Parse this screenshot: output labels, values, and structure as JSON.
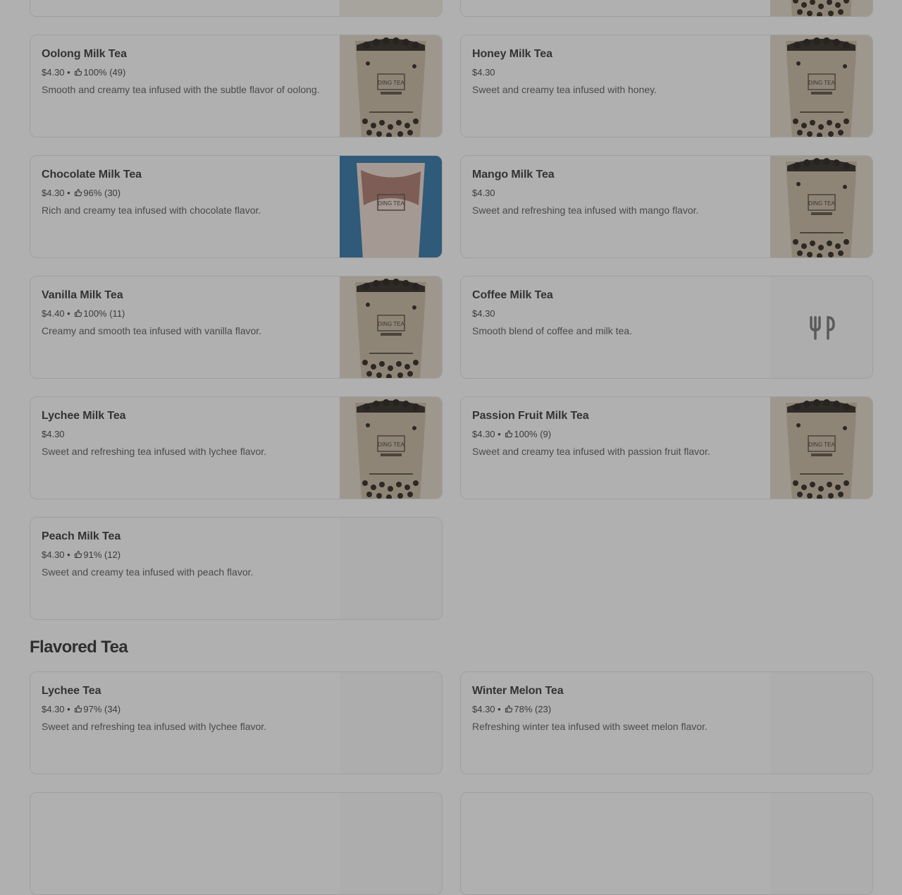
{
  "cards": {
    "oolong": {
      "name": "Oolong Milk Tea",
      "price": "$4.30",
      "sep": "•",
      "rating": "100% (49)",
      "description": "Smooth and creamy tea infused with the subtle flavor of oolong."
    },
    "honey": {
      "name": "Honey Milk Tea",
      "price": "$4.30",
      "description": "Sweet and creamy tea infused with honey."
    },
    "chocolate": {
      "name": "Chocolate Milk Tea",
      "price": "$4.30",
      "sep": "•",
      "rating": "96% (30)",
      "description": "Rich and creamy tea infused with chocolate flavor."
    },
    "mango": {
      "name": "Mango Milk Tea",
      "price": "$4.30",
      "description": "Sweet and refreshing tea infused with mango flavor."
    },
    "vanilla": {
      "name": "Vanilla Milk Tea",
      "price": "$4.40",
      "sep": "•",
      "rating": "100% (11)",
      "description": "Creamy and smooth tea infused with vanilla flavor."
    },
    "coffee": {
      "name": "Coffee Milk Tea",
      "price": "$4.30",
      "description": "Smooth blend of coffee and milk tea.",
      "icon": "utensils-icon"
    },
    "lychee": {
      "name": "Lychee Milk Tea",
      "price": "$4.30",
      "description": "Sweet and refreshing tea infused with lychee flavor."
    },
    "passion": {
      "name": "Passion Fruit Milk Tea",
      "price": "$4.30",
      "sep": "•",
      "rating": "100% (9)",
      "description": "Sweet and creamy tea infused with passion fruit flavor."
    },
    "peach": {
      "name": "Peach Milk Tea",
      "price": "$4.30",
      "sep": "•",
      "rating": "91% (12)",
      "description": "Sweet and creamy tea infused with peach flavor."
    },
    "lychee_tea": {
      "name": "Lychee Tea",
      "price": "$4.30",
      "sep": "•",
      "rating": "97% (34)",
      "description": "Sweet and refreshing tea infused with lychee flavor."
    },
    "winter_melon": {
      "name": "Winter Melon Tea",
      "price": "$4.30",
      "sep": "•",
      "rating": "78% (23)",
      "description": "Refreshing winter tea infused with sweet melon flavor."
    }
  },
  "sections": {
    "flavored_tea": "Flavored Tea"
  },
  "cup_label": "DING TEA",
  "icons": {
    "rating": "thumbs-up-icon"
  },
  "colors": {
    "overlay": "#b0b0b0",
    "card_border": "#9f9f9f",
    "text": "#2f2f2f"
  }
}
